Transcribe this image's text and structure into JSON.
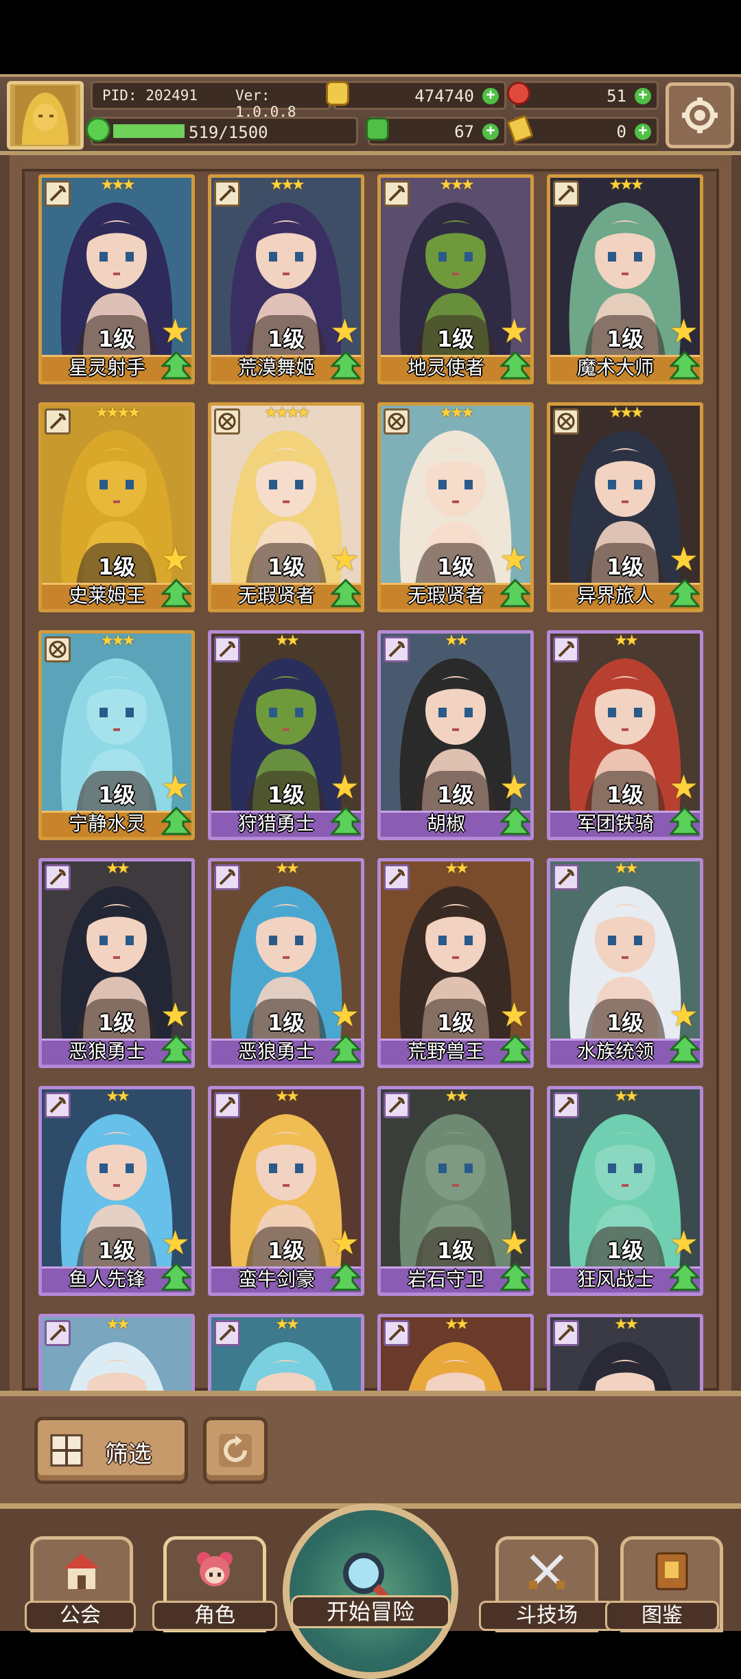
{
  "header": {
    "pid": "PID: 202491",
    "version": "Ver: 1.0.0.8",
    "exp": "519/1500",
    "exp_progress": 0.346,
    "gold": "474740",
    "gems": "51",
    "clover": "67",
    "token": "0"
  },
  "heroes": [
    {
      "name": "星灵射手",
      "level": "1级",
      "stars": "★★★",
      "frame": "gold",
      "hair": "#2e2a5a",
      "skin": "#f2d2c0",
      "bg": "#3a6a8a",
      "cls": "bow"
    },
    {
      "name": "荒漠舞姬",
      "level": "1级",
      "stars": "★★★",
      "frame": "gold",
      "hair": "#3a2f63",
      "skin": "#f2d2c0",
      "bg": "#3e4e66",
      "cls": "bow"
    },
    {
      "name": "地灵使者",
      "level": "1级",
      "stars": "★★★",
      "frame": "gold",
      "hair": "#2f2b44",
      "skin": "#6f9a3c",
      "bg": "#5a4d6e",
      "cls": "bow"
    },
    {
      "name": "魔术大师",
      "level": "1级",
      "stars": "★★★",
      "frame": "gold",
      "hair": "#6ea78a",
      "skin": "#f2d2c0",
      "bg": "#2c2a3a",
      "cls": "bow"
    },
    {
      "name": "史莱姆王",
      "level": "1级",
      "stars": "★★★★",
      "frame": "gold",
      "hair": "#d9a82a",
      "skin": "#e8b83a",
      "bg": "#c89a2e",
      "cls": "bow"
    },
    {
      "name": "无瑕贤者",
      "level": "1级",
      "stars": "★★★★",
      "frame": "gold",
      "hair": "#f2d27a",
      "skin": "#f6dccb",
      "bg": "#e9d7c4",
      "cls": "cross"
    },
    {
      "name": "无瑕贤者",
      "level": "1级",
      "stars": "★★★",
      "frame": "gold",
      "hair": "#efe6d8",
      "skin": "#f6dccb",
      "bg": "#7fb0b7",
      "cls": "cross"
    },
    {
      "name": "异界旅人",
      "level": "1级",
      "stars": "★★★",
      "frame": "gold",
      "hair": "#2c3344",
      "skin": "#f2d2c0",
      "bg": "#3b2e2a",
      "cls": "cross"
    },
    {
      "name": "宁静水灵",
      "level": "1级",
      "stars": "★★★",
      "frame": "gold",
      "hair": "#8fd8e6",
      "skin": "#a6e2ec",
      "bg": "#5aa3b8",
      "cls": "cross"
    },
    {
      "name": "狩猎勇士",
      "level": "1级",
      "stars": "★★",
      "frame": "purple",
      "hair": "#2a2e5a",
      "skin": "#6f9a3c",
      "bg": "#4a3a2c",
      "cls": "axe"
    },
    {
      "name": "胡椒",
      "level": "1级",
      "stars": "★★",
      "frame": "purple",
      "hair": "#2a2a2a",
      "skin": "#f2d2c0",
      "bg": "#4a5a6e",
      "cls": "axe"
    },
    {
      "name": "军团铁骑",
      "level": "1级",
      "stars": "★★",
      "frame": "purple",
      "hair": "#b84030",
      "skin": "#f2d2c0",
      "bg": "#4a3a30",
      "cls": "axe"
    },
    {
      "name": "恶狼勇士",
      "level": "1级",
      "stars": "★★",
      "frame": "purple",
      "hair": "#232635",
      "skin": "#f2d2c0",
      "bg": "#3e3a3e",
      "cls": "axe"
    },
    {
      "name": "恶狼勇士",
      "level": "1级",
      "stars": "★★",
      "frame": "purple",
      "hair": "#4aa7d0",
      "skin": "#f2d2c0",
      "bg": "#6a4a33",
      "cls": "axe"
    },
    {
      "name": "荒野兽王",
      "level": "1级",
      "stars": "★★",
      "frame": "purple",
      "hair": "#3a2a24",
      "skin": "#f2d2c0",
      "bg": "#7a4c2c",
      "cls": "axe"
    },
    {
      "name": "水族统领",
      "level": "1级",
      "stars": "★★",
      "frame": "purple",
      "hair": "#e6ecf2",
      "skin": "#f2d2c0",
      "bg": "#4e6e6a",
      "cls": "axe"
    },
    {
      "name": "鱼人先锋",
      "level": "1级",
      "stars": "★★",
      "frame": "purple",
      "hair": "#66c0ea",
      "skin": "#f2d2c0",
      "bg": "#2e4c6a",
      "cls": "axe"
    },
    {
      "name": "蛮牛剑豪",
      "level": "1级",
      "stars": "★★",
      "frame": "purple",
      "hair": "#f0bc54",
      "skin": "#f2d2c0",
      "bg": "#5a3a2e",
      "cls": "axe"
    },
    {
      "name": "岩石守卫",
      "level": "1级",
      "stars": "★★",
      "frame": "purple",
      "hair": "#6e8a72",
      "skin": "#7e9a82",
      "bg": "#3a3e3a",
      "cls": "axe"
    },
    {
      "name": "狂风战士",
      "level": "1级",
      "stars": "★★",
      "frame": "purple",
      "hair": "#6fcfb0",
      "skin": "#8ad8c0",
      "bg": "#3a4a4e",
      "cls": "axe"
    },
    {
      "name": "",
      "level": "",
      "stars": "★★",
      "frame": "purple",
      "hair": "#dcecf4",
      "skin": "#f2d2c0",
      "bg": "#7aa6c0",
      "cls": "axe"
    },
    {
      "name": "",
      "level": "",
      "stars": "★★",
      "frame": "purple",
      "hair": "#7ad0e0",
      "skin": "#f2d2c0",
      "bg": "#3e7a8e",
      "cls": "axe"
    },
    {
      "name": "",
      "level": "",
      "stars": "★★",
      "frame": "purple",
      "hair": "#e8a83a",
      "skin": "#f2d2c0",
      "bg": "#6a3a2a",
      "cls": "axe"
    },
    {
      "name": "",
      "level": "",
      "stars": "★★",
      "frame": "purple",
      "hair": "#2a2a36",
      "skin": "#f2d2c0",
      "bg": "#3a3a44",
      "cls": "axe"
    }
  ],
  "controls": {
    "filter_label": "筛选"
  },
  "nav": {
    "guild": "公会",
    "heroes": "角色",
    "adventure": "开始冒险",
    "arena": "斗技场",
    "codex": "图鉴"
  },
  "colors": {
    "gold_frame": "#d39a3c",
    "purple_frame": "#b48ad6",
    "plus_green": "#4fbf46",
    "exp_green": "#6fd05a"
  }
}
